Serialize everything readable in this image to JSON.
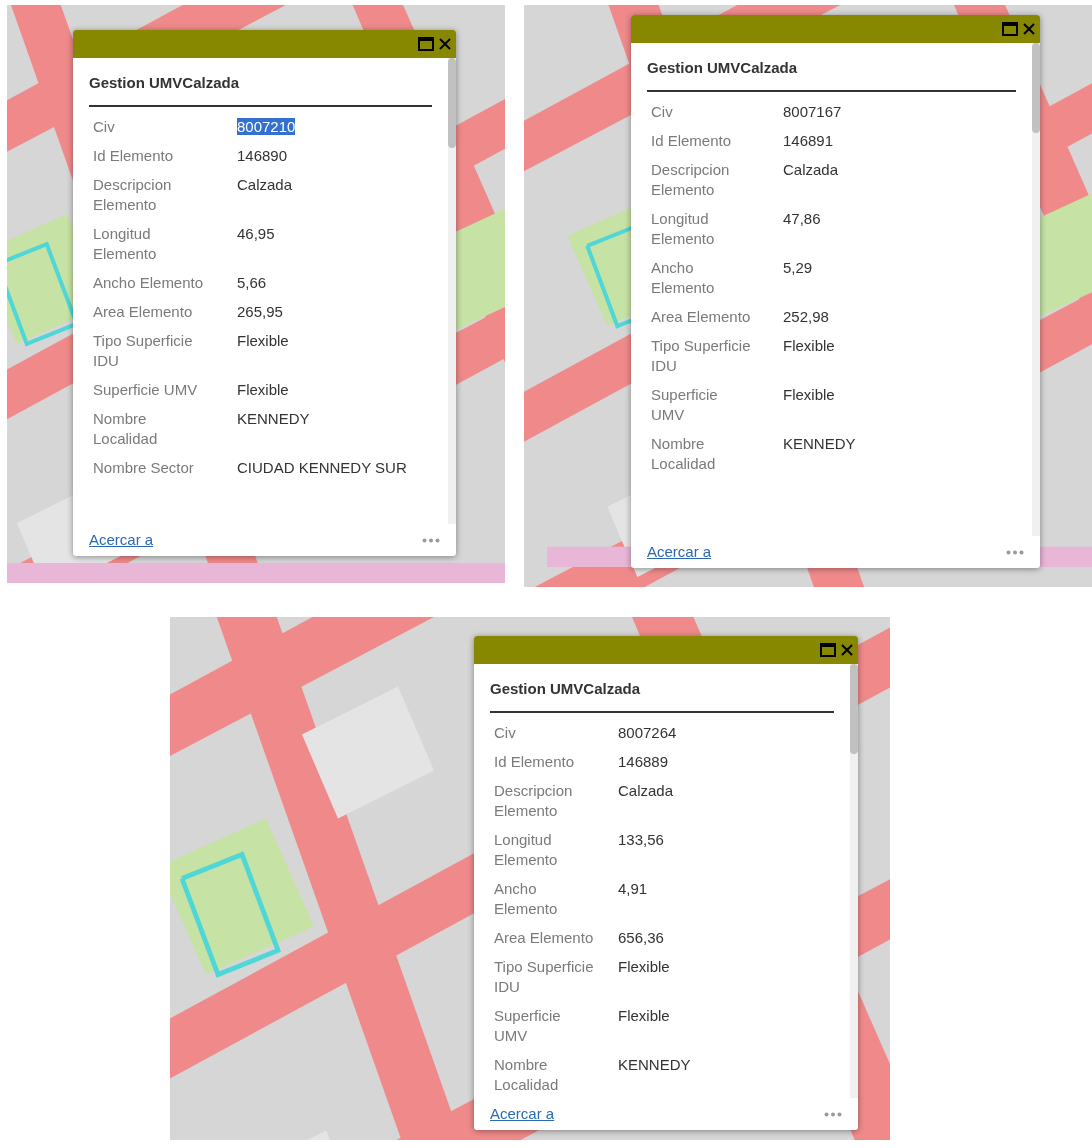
{
  "panels": [
    {
      "popup": {
        "title": "Gestion UMVCalzada",
        "link": "Acercar a",
        "rows": [
          {
            "label": "Civ",
            "value": "8007210",
            "selected": true
          },
          {
            "label": "Id Elemento",
            "value": "146890",
            "selected": false
          },
          {
            "label": "Descripcion Elemento",
            "value": "Calzada",
            "selected": false
          },
          {
            "label": "Longitud Elemento",
            "value": "46,95",
            "selected": false
          },
          {
            "label": "Ancho Elemento",
            "value": "5,66",
            "selected": false
          },
          {
            "label": "Area Elemento",
            "value": "265,95",
            "selected": false
          },
          {
            "label": "Tipo Superficie IDU",
            "value": "Flexible",
            "selected": false
          },
          {
            "label": "Superficie UMV",
            "value": "Flexible",
            "selected": false
          },
          {
            "label": "Nombre Localidad",
            "value": "KENNEDY",
            "selected": false
          },
          {
            "label": "Nombre Sector",
            "value": "CIUDAD KENNEDY SUR",
            "selected": false
          }
        ]
      }
    },
    {
      "popup": {
        "title": "Gestion UMVCalzada",
        "link": "Acercar a",
        "rows": [
          {
            "label": "Civ",
            "value": "8007167"
          },
          {
            "label": "Id Elemento",
            "value": "146891"
          },
          {
            "label": "Descripcion Elemento",
            "value": "Calzada"
          },
          {
            "label": "Longitud Elemento",
            "value": "47,86"
          },
          {
            "label": "Ancho Elemento",
            "value": "5,29"
          },
          {
            "label": "Area Elemento",
            "value": "252,98"
          },
          {
            "label": "Tipo Superficie IDU",
            "value": "Flexible"
          },
          {
            "label": "Superficie UMV",
            "value": "Flexible"
          },
          {
            "label": "Nombre Localidad",
            "value": "KENNEDY"
          }
        ]
      }
    },
    {
      "popup": {
        "title": "Gestion UMVCalzada",
        "link": "Acercar a",
        "rows": [
          {
            "label": "Civ",
            "value": "8007264"
          },
          {
            "label": "Id Elemento",
            "value": "146889"
          },
          {
            "label": "Descripcion Elemento",
            "value": "Calzada"
          },
          {
            "label": "Longitud Elemento",
            "value": "133,56"
          },
          {
            "label": "Ancho Elemento",
            "value": "4,91"
          },
          {
            "label": "Area Elemento",
            "value": "656,36"
          },
          {
            "label": "Tipo Superficie IDU",
            "value": "Flexible"
          },
          {
            "label": "Superficie UMV",
            "value": "Flexible"
          },
          {
            "label": "Nombre Localidad",
            "value": "KENNEDY"
          }
        ]
      }
    }
  ]
}
